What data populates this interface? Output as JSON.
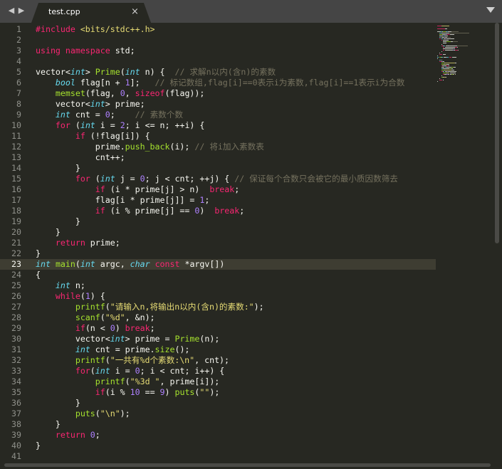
{
  "nav": {
    "left_arrow": "◀",
    "right_arrow": "▶"
  },
  "tab": {
    "label": "test.cpp",
    "close": "×"
  },
  "active_line": 23,
  "colors": {
    "keyword": "#f92672",
    "type": "#66d9ef",
    "function": "#a6e22e",
    "number": "#ae81ff",
    "string": "#e6db74",
    "comment": "#75715e",
    "text": "#f8f8f2"
  },
  "lines": [
    [
      [
        "kw",
        "#include "
      ],
      [
        "str",
        "<bits/stdc++.h>"
      ]
    ],
    [],
    [
      [
        "kw",
        "using namespace "
      ],
      [
        "tx",
        "std;"
      ]
    ],
    [],
    [
      [
        "tx",
        "vector<"
      ],
      [
        "ty",
        "int"
      ],
      [
        "tx",
        "> "
      ],
      [
        "fn",
        "Prime"
      ],
      [
        "tx",
        "("
      ],
      [
        "ty",
        "int"
      ],
      [
        "tx",
        " n) {  "
      ],
      [
        "cm",
        "// 求解n以内(含n)的素数"
      ]
    ],
    [
      [
        "tx",
        "    "
      ],
      [
        "ty",
        "bool"
      ],
      [
        "tx",
        " flag[n + "
      ],
      [
        "num",
        "1"
      ],
      [
        "tx",
        "];   "
      ],
      [
        "cm",
        "// 标记数组,flag[i]==0表示i为素数,flag[i]==1表示i为合数"
      ]
    ],
    [
      [
        "tx",
        "    "
      ],
      [
        "fn",
        "memset"
      ],
      [
        "tx",
        "(flag, "
      ],
      [
        "num",
        "0"
      ],
      [
        "tx",
        ", "
      ],
      [
        "kw",
        "sizeof"
      ],
      [
        "tx",
        "(flag));"
      ]
    ],
    [
      [
        "tx",
        "    vector<"
      ],
      [
        "ty",
        "int"
      ],
      [
        "tx",
        "> prime;"
      ]
    ],
    [
      [
        "tx",
        "    "
      ],
      [
        "ty",
        "int"
      ],
      [
        "tx",
        " cnt = "
      ],
      [
        "num",
        "0"
      ],
      [
        "tx",
        ";    "
      ],
      [
        "cm",
        "// 素数个数"
      ]
    ],
    [
      [
        "tx",
        "    "
      ],
      [
        "kw",
        "for"
      ],
      [
        "tx",
        " ("
      ],
      [
        "ty",
        "int"
      ],
      [
        "tx",
        " i = "
      ],
      [
        "num",
        "2"
      ],
      [
        "tx",
        "; i <= n; ++i) {"
      ]
    ],
    [
      [
        "tx",
        "        "
      ],
      [
        "kw",
        "if"
      ],
      [
        "tx",
        " (!flag[i]) {"
      ]
    ],
    [
      [
        "tx",
        "            prime."
      ],
      [
        "fn",
        "push_back"
      ],
      [
        "tx",
        "(i); "
      ],
      [
        "cm",
        "// 将i加入素数表"
      ]
    ],
    [
      [
        "tx",
        "            cnt++;"
      ]
    ],
    [
      [
        "tx",
        "        }"
      ]
    ],
    [
      [
        "tx",
        "        "
      ],
      [
        "kw",
        "for"
      ],
      [
        "tx",
        " ("
      ],
      [
        "ty",
        "int"
      ],
      [
        "tx",
        " j = "
      ],
      [
        "num",
        "0"
      ],
      [
        "tx",
        "; j < cnt; ++j) { "
      ],
      [
        "cm",
        "// 保证每个合数只会被它的最小质因数筛去"
      ]
    ],
    [
      [
        "tx",
        "            "
      ],
      [
        "kw",
        "if"
      ],
      [
        "tx",
        " (i * prime[j] > n)  "
      ],
      [
        "kw",
        "break"
      ],
      [
        "tx",
        ";"
      ]
    ],
    [
      [
        "tx",
        "            flag[i * prime[j]] = "
      ],
      [
        "num",
        "1"
      ],
      [
        "tx",
        ";"
      ]
    ],
    [
      [
        "tx",
        "            "
      ],
      [
        "kw",
        "if"
      ],
      [
        "tx",
        " (i % prime[j] == "
      ],
      [
        "num",
        "0"
      ],
      [
        "tx",
        ")  "
      ],
      [
        "kw",
        "break"
      ],
      [
        "tx",
        ";"
      ]
    ],
    [
      [
        "tx",
        "        }"
      ]
    ],
    [
      [
        "tx",
        "    }"
      ]
    ],
    [
      [
        "tx",
        "    "
      ],
      [
        "kw",
        "return"
      ],
      [
        "tx",
        " prime;"
      ]
    ],
    [
      [
        "tx",
        "}"
      ]
    ],
    [
      [
        "ty",
        "int"
      ],
      [
        "tx",
        " "
      ],
      [
        "fn",
        "main"
      ],
      [
        "tx",
        "("
      ],
      [
        "ty",
        "int"
      ],
      [
        "tx",
        " argc, "
      ],
      [
        "ty",
        "char"
      ],
      [
        "tx",
        " "
      ],
      [
        "kw",
        "const"
      ],
      [
        "tx",
        " *argv[])"
      ]
    ],
    [
      [
        "tx",
        "{"
      ]
    ],
    [
      [
        "tx",
        "    "
      ],
      [
        "ty",
        "int"
      ],
      [
        "tx",
        " n;"
      ]
    ],
    [
      [
        "tx",
        "    "
      ],
      [
        "kw",
        "while"
      ],
      [
        "tx",
        "("
      ],
      [
        "num",
        "1"
      ],
      [
        "tx",
        ") {"
      ]
    ],
    [
      [
        "tx",
        "        "
      ],
      [
        "fn",
        "printf"
      ],
      [
        "tx",
        "("
      ],
      [
        "str",
        "\"请输入n,将输出n以内(含n)的素数:\""
      ],
      [
        "tx",
        ");"
      ]
    ],
    [
      [
        "tx",
        "        "
      ],
      [
        "fn",
        "scanf"
      ],
      [
        "tx",
        "("
      ],
      [
        "str",
        "\"%d\""
      ],
      [
        "tx",
        ", &n);"
      ]
    ],
    [
      [
        "tx",
        "        "
      ],
      [
        "kw",
        "if"
      ],
      [
        "tx",
        "(n < "
      ],
      [
        "num",
        "0"
      ],
      [
        "tx",
        ") "
      ],
      [
        "kw",
        "break"
      ],
      [
        "tx",
        ";"
      ]
    ],
    [
      [
        "tx",
        "        vector<"
      ],
      [
        "ty",
        "int"
      ],
      [
        "tx",
        "> prime = "
      ],
      [
        "fn",
        "Prime"
      ],
      [
        "tx",
        "(n);"
      ]
    ],
    [
      [
        "tx",
        "        "
      ],
      [
        "ty",
        "int"
      ],
      [
        "tx",
        " cnt = prime."
      ],
      [
        "fn",
        "size"
      ],
      [
        "tx",
        "();"
      ]
    ],
    [
      [
        "tx",
        "        "
      ],
      [
        "fn",
        "printf"
      ],
      [
        "tx",
        "("
      ],
      [
        "str",
        "\"一共有%d个素数:\\n\""
      ],
      [
        "tx",
        ", cnt);"
      ]
    ],
    [
      [
        "tx",
        "        "
      ],
      [
        "kw",
        "for"
      ],
      [
        "tx",
        "("
      ],
      [
        "ty",
        "int"
      ],
      [
        "tx",
        " i = "
      ],
      [
        "num",
        "0"
      ],
      [
        "tx",
        "; i < cnt; i++) {"
      ]
    ],
    [
      [
        "tx",
        "            "
      ],
      [
        "fn",
        "printf"
      ],
      [
        "tx",
        "("
      ],
      [
        "str",
        "\"%3d \""
      ],
      [
        "tx",
        ", prime[i]);"
      ]
    ],
    [
      [
        "tx",
        "            "
      ],
      [
        "kw",
        "if"
      ],
      [
        "tx",
        "(i % "
      ],
      [
        "num",
        "10"
      ],
      [
        "tx",
        " == "
      ],
      [
        "num",
        "9"
      ],
      [
        "tx",
        ") "
      ],
      [
        "fn",
        "puts"
      ],
      [
        "tx",
        "("
      ],
      [
        "str",
        "\"\""
      ],
      [
        "tx",
        ");"
      ]
    ],
    [
      [
        "tx",
        "        }"
      ]
    ],
    [
      [
        "tx",
        "        "
      ],
      [
        "fn",
        "puts"
      ],
      [
        "tx",
        "("
      ],
      [
        "str",
        "\"\\n\""
      ],
      [
        "tx",
        ");"
      ]
    ],
    [
      [
        "tx",
        "    }"
      ]
    ],
    [
      [
        "tx",
        "    "
      ],
      [
        "kw",
        "return"
      ],
      [
        "tx",
        " "
      ],
      [
        "num",
        "0"
      ],
      [
        "tx",
        ";"
      ]
    ],
    [
      [
        "tx",
        "}"
      ]
    ],
    []
  ]
}
